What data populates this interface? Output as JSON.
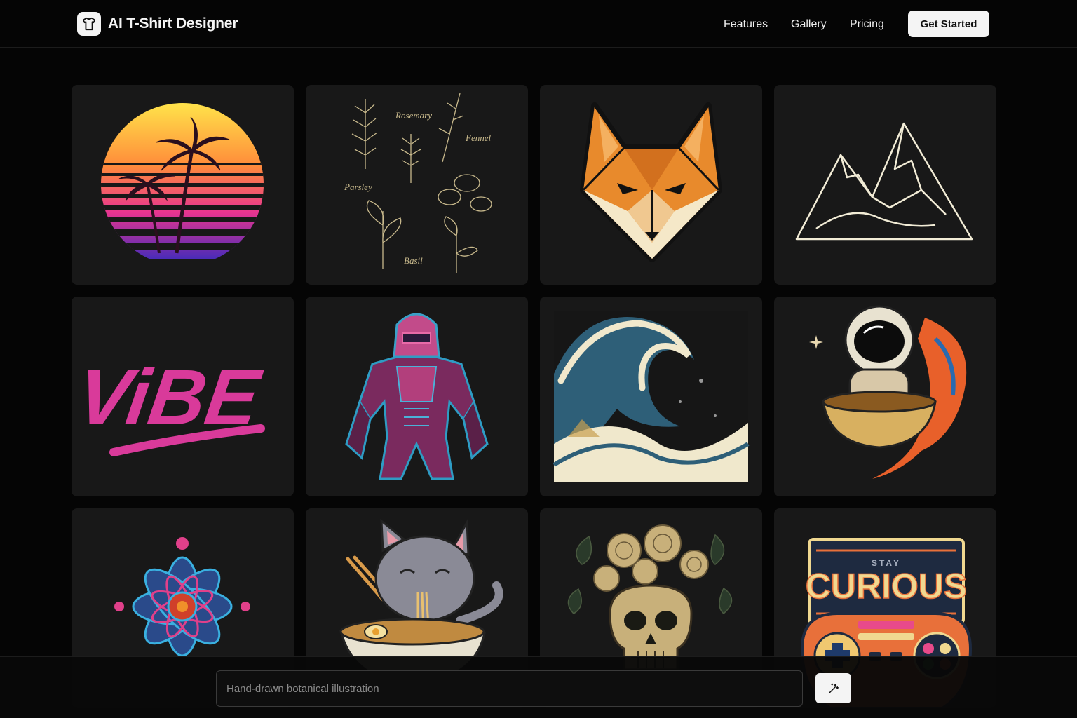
{
  "header": {
    "brand_name": "AI T-Shirt Designer",
    "logo_icon": "tshirt-icon",
    "nav": [
      "Features",
      "Gallery",
      "Pricing"
    ],
    "cta_label": "Get Started"
  },
  "gallery": {
    "designs": [
      {
        "name": "retro-sunset-palms"
      },
      {
        "name": "botanical-herbs",
        "labels": [
          "Rosemary",
          "Fennel",
          "Parsley",
          "Basil"
        ]
      },
      {
        "name": "geometric-fox"
      },
      {
        "name": "line-art-mountains"
      },
      {
        "name": "vibe-brush-lettering",
        "text": "ViBE"
      },
      {
        "name": "neon-mech-warrior"
      },
      {
        "name": "great-wave"
      },
      {
        "name": "astronaut-koi-ramen"
      },
      {
        "name": "psychedelic-mandala"
      },
      {
        "name": "cat-eating-ramen"
      },
      {
        "name": "floral-skull"
      },
      {
        "name": "retro-gamepad",
        "text": "CURIOUS",
        "subtext": "STAY"
      }
    ]
  },
  "prompt_bar": {
    "placeholder": "Hand-drawn botanical illustration",
    "generate_icon": "magic-wand-icon"
  },
  "colors": {
    "background": "#050505",
    "card": "#181818",
    "accent_light": "#f4f4f4"
  }
}
